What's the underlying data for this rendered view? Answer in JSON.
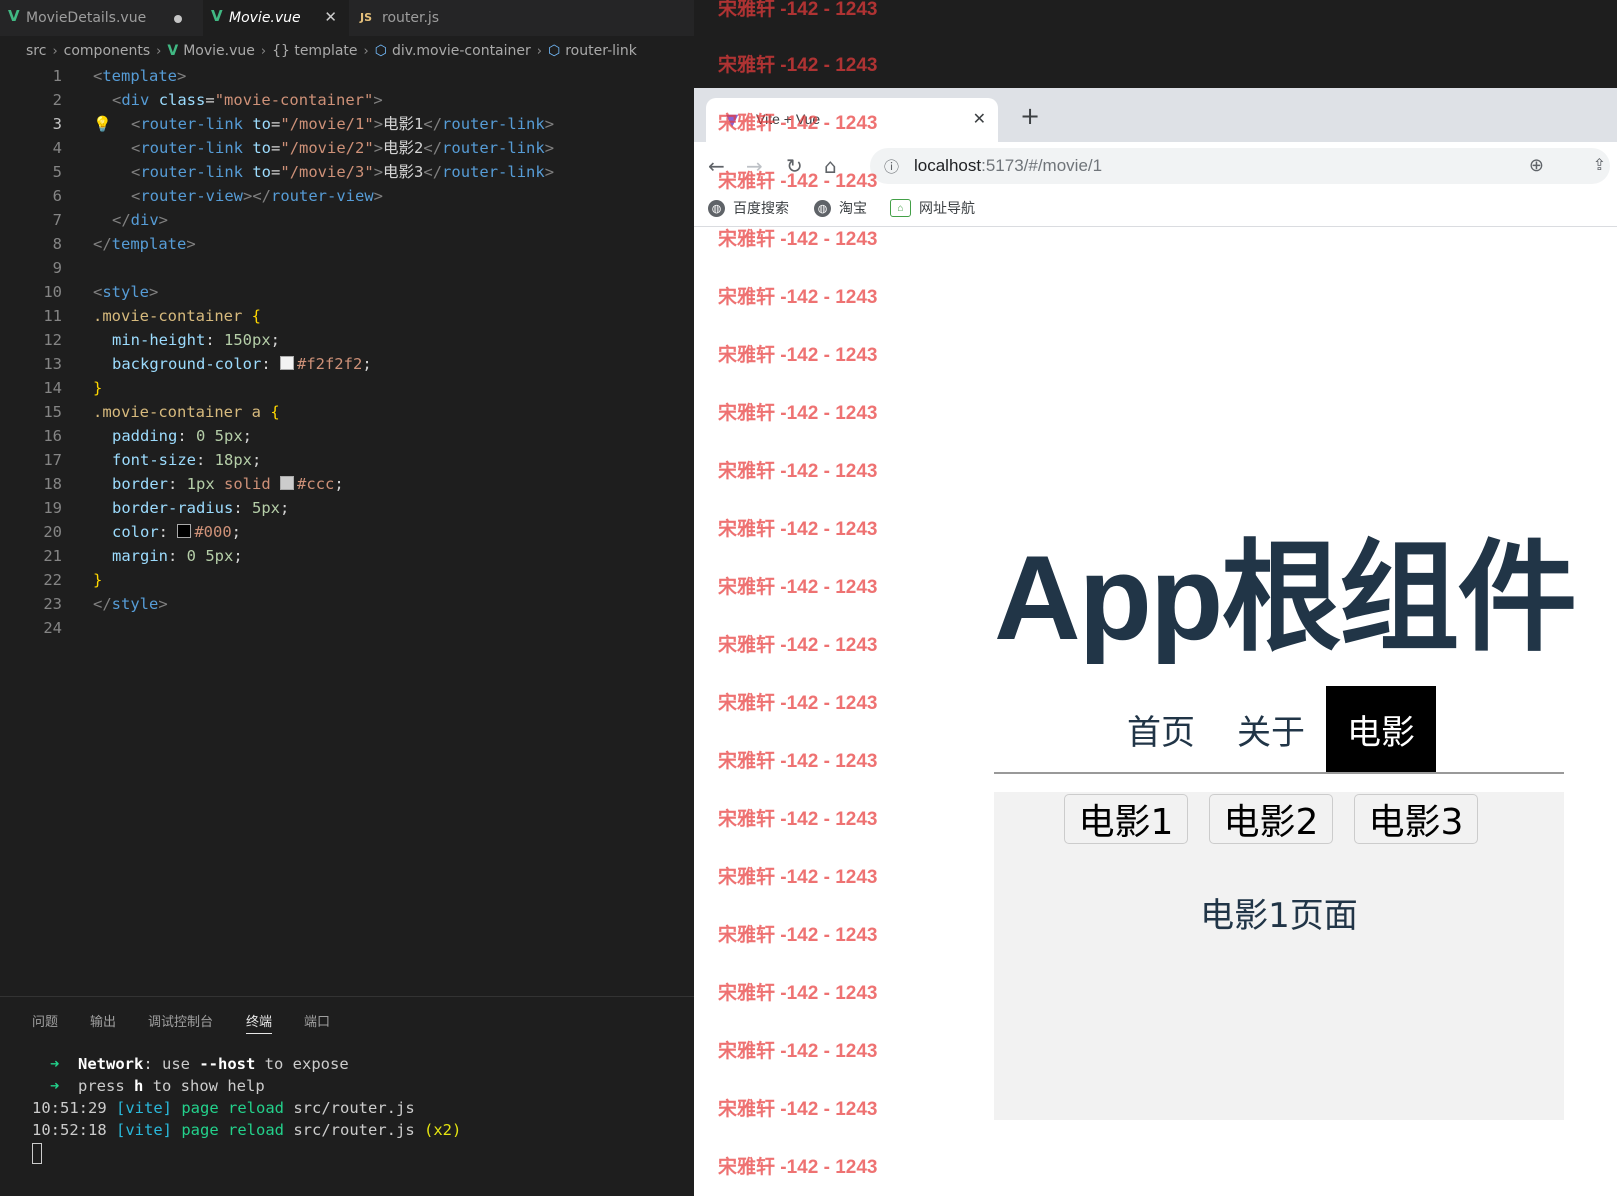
{
  "editor": {
    "tabs": [
      {
        "label": "MovieDetails.vue",
        "icon": "vue-icon",
        "modified": true
      },
      {
        "label": "Movie.vue",
        "icon": "vue-icon",
        "active": true
      },
      {
        "label": "router.js",
        "icon": "js-icon",
        "badge": "JS"
      }
    ],
    "breadcrumb": [
      "src",
      "components",
      "Movie.vue",
      "{} template",
      "div.movie-container",
      "router-link"
    ],
    "current_line": 3
  },
  "code_lines": [
    {
      "n": "1"
    },
    {
      "n": "2"
    },
    {
      "n": "3"
    },
    {
      "n": "4"
    },
    {
      "n": "5"
    },
    {
      "n": "6"
    },
    {
      "n": "7"
    },
    {
      "n": "8"
    },
    {
      "n": "9"
    },
    {
      "n": "10"
    },
    {
      "n": "11"
    },
    {
      "n": "12"
    },
    {
      "n": "13"
    },
    {
      "n": "14"
    },
    {
      "n": "15"
    },
    {
      "n": "16"
    },
    {
      "n": "17"
    },
    {
      "n": "18"
    },
    {
      "n": "19"
    },
    {
      "n": "20"
    },
    {
      "n": "21"
    },
    {
      "n": "22"
    },
    {
      "n": "23"
    },
    {
      "n": "24"
    }
  ],
  "code": {
    "l1_tag": "template",
    "l2_tag": "div",
    "l2_attr": "class",
    "l2_val": "\"movie-container\"",
    "l3_tag": "router-link",
    "l3_attr": "to",
    "l3_val": "\"/movie/1\"",
    "l3_text": "电影1",
    "l4_tag": "router-link",
    "l4_attr": "to",
    "l4_val": "\"/movie/2\"",
    "l4_text": "电影2",
    "l5_tag": "router-link",
    "l5_attr": "to",
    "l5_val": "\"/movie/3\"",
    "l5_text": "电影3",
    "l6_tag": "router-view",
    "l7_tag": "div",
    "l8_tag": "template",
    "l10_tag": "style",
    "l11_sel": ".movie-container",
    "l12_prop": "min-height",
    "l12_val": "150px",
    "l13_prop": "background-color",
    "l13_val": "#f2f2f2",
    "l13_swatch": "#f2f2f2",
    "l15_sel": ".movie-container a",
    "l16_prop": "padding",
    "l16_val": "0 5px",
    "l17_prop": "font-size",
    "l17_val": "18px",
    "l18_prop": "border",
    "l18_num": "1px",
    "l18_kw": "solid",
    "l18_val": "#ccc",
    "l18_swatch": "#cccccc",
    "l19_prop": "border-radius",
    "l19_val": "5px",
    "l20_prop": "color",
    "l20_val": "#000",
    "l20_swatch": "#000000",
    "l21_prop": "margin",
    "l21_val": "0 5px",
    "l23_tag": "style"
  },
  "panel": {
    "tabs": [
      "问题",
      "输出",
      "调试控制台",
      "终端",
      "端口"
    ],
    "active_tab": "终端",
    "terminal": {
      "l1_arrow": "➜",
      "l1_label": "Network",
      "l1_a": ": use ",
      "l1_flag": "--host",
      "l1_b": " to expose",
      "l2_arrow": "➜",
      "l2_a": "press ",
      "l2_key": "h",
      "l2_b": " to show help",
      "l3_time": "10:51:29",
      "l3_tag": "[vite]",
      "l3_action": "page reload",
      "l3_file": "src/router.js",
      "l4_time": "10:52:18",
      "l4_tag": "[vite]",
      "l4_action": "page reload",
      "l4_file": "src/router.js",
      "l4_count": "(x2)"
    }
  },
  "browser": {
    "tab_title": "Vite + Vue",
    "url_host": "localhost",
    "url_path": ":5173/#/movie/1",
    "bookmarks": [
      "百度搜索",
      "淘宝",
      "网址导航"
    ],
    "page": {
      "title": "App根组件",
      "nav": [
        {
          "label": "首页",
          "active": false
        },
        {
          "label": "关于",
          "active": false
        },
        {
          "label": "电影",
          "active": true
        }
      ],
      "movie_links": [
        "电影1",
        "电影2",
        "电影3"
      ],
      "movie_page_text": "电影1页面"
    }
  },
  "watermark": {
    "text": "宋雅轩 -142 - 1243",
    "color": "#e83c3c"
  },
  "colors": {
    "editor_bg": "#1e1e1e",
    "vue_green": "#41b883",
    "nav_active_bg": "#000000",
    "container_bg": "#f2f2f2",
    "heading_color": "#213547"
  }
}
